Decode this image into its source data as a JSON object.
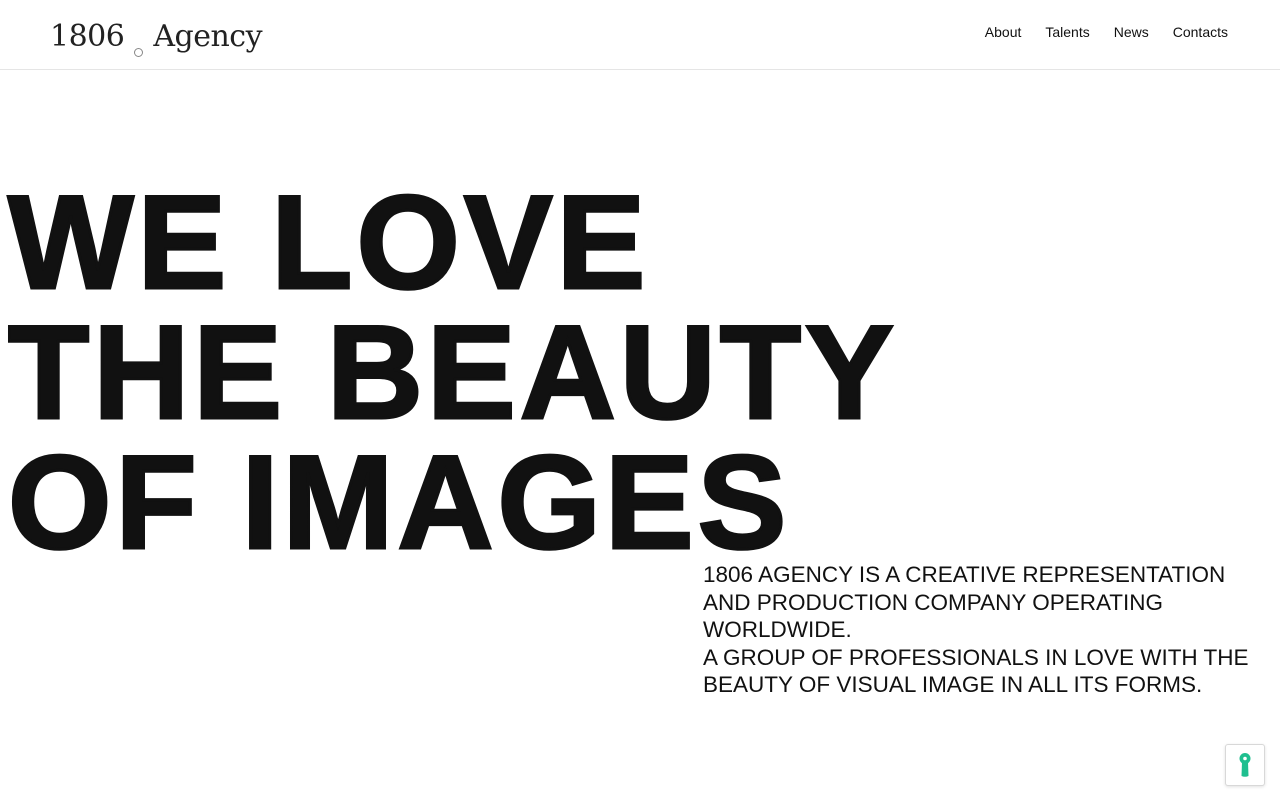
{
  "header": {
    "logo": {
      "part1": "1806",
      "part2": "Agency"
    },
    "nav": [
      {
        "label": "About"
      },
      {
        "label": "Talents"
      },
      {
        "label": "News"
      },
      {
        "label": "Contacts"
      }
    ]
  },
  "hero": {
    "lines": [
      "WE LOVE",
      "THE BEAUTY",
      "OF IMAGES"
    ]
  },
  "description": {
    "paragraph1": "1806 AGENCY IS A CREATIVE REPRESENTATION AND PRODUCTION COMPANY OPERATING WORLDWIDE.",
    "paragraph2": "A GROUP OF PROFESSIONALS IN LOVE WITH THE BEAUTY OF VISUAL IMAGE IN ALL ITS FORMS."
  },
  "widget": {
    "icon": "keyhole-icon",
    "color": "#1fbf8f"
  },
  "colors": {
    "text": "#111111",
    "border": "#e5e5e5",
    "accent": "#1fbf8f"
  }
}
